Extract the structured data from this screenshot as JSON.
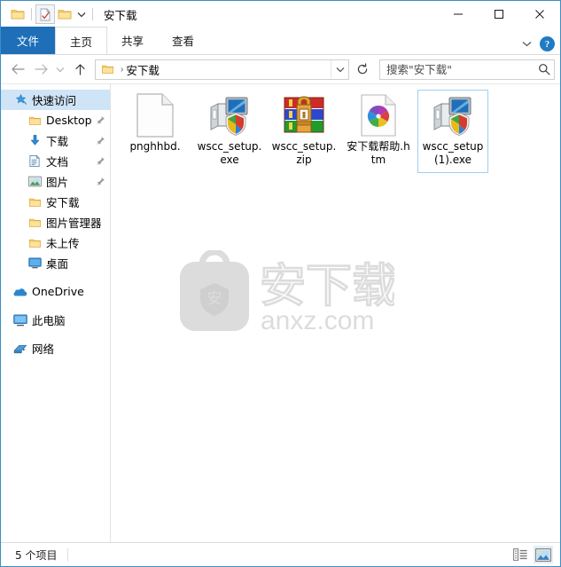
{
  "window": {
    "title": "安下载",
    "quick_access_toolbar": [
      {
        "name": "folder-icon",
        "label": "文件夹"
      },
      {
        "name": "properties-icon",
        "label": "属性"
      },
      {
        "name": "new-folder-icon",
        "label": "新建文件夹"
      },
      {
        "name": "chevron-down-icon",
        "label": "自定义快速访问工具栏"
      }
    ],
    "controls": {
      "minimize": "—",
      "maximize": "▢",
      "close": "✕"
    }
  },
  "ribbon": {
    "tabs": [
      {
        "label": "文件",
        "type": "file"
      },
      {
        "label": "主页",
        "type": "normal"
      },
      {
        "label": "共享",
        "type": "normal"
      },
      {
        "label": "查看",
        "type": "normal"
      }
    ],
    "expand_label": "⌄",
    "help_label": "?"
  },
  "address": {
    "back_label": "←",
    "forward_label": "→",
    "recent_label": "⌄",
    "up_label": "↑",
    "breadcrumb": [
      "安下载"
    ],
    "breadcrumb_separator": "›",
    "dropdown_label": "⌄",
    "refresh_label": "↻"
  },
  "search": {
    "placeholder": "搜索\"安下载\"",
    "value": "",
    "icon": "search-icon"
  },
  "sidebar": {
    "items": [
      {
        "label": "快速访问",
        "icon": "star-pin-icon",
        "level": 0,
        "selected": true,
        "pinned": false
      },
      {
        "label": "Desktop",
        "icon": "folder-icon",
        "level": 1,
        "selected": false,
        "pinned": true
      },
      {
        "label": "下载",
        "icon": "downloads-icon",
        "level": 1,
        "selected": false,
        "pinned": true
      },
      {
        "label": "文档",
        "icon": "documents-icon",
        "level": 1,
        "selected": false,
        "pinned": true
      },
      {
        "label": "图片",
        "icon": "pictures-icon",
        "level": 1,
        "selected": false,
        "pinned": true
      },
      {
        "label": "安下载",
        "icon": "folder-icon",
        "level": 1,
        "selected": false,
        "pinned": false
      },
      {
        "label": "图片管理器",
        "icon": "folder-icon",
        "level": 1,
        "selected": false,
        "pinned": false
      },
      {
        "label": "未上传",
        "icon": "folder-icon",
        "level": 1,
        "selected": false,
        "pinned": false
      },
      {
        "label": "桌面",
        "icon": "desktop-icon",
        "level": 1,
        "selected": false,
        "pinned": false
      },
      {
        "label": "OneDrive",
        "icon": "onedrive-icon",
        "level": 0,
        "selected": false,
        "pinned": false,
        "gap_before": true
      },
      {
        "label": "此电脑",
        "icon": "this-pc-icon",
        "level": 0,
        "selected": false,
        "pinned": false,
        "gap_before": true
      },
      {
        "label": "网络",
        "icon": "network-icon",
        "level": 0,
        "selected": false,
        "pinned": false,
        "gap_before": true
      }
    ]
  },
  "files": [
    {
      "name": "pnghhbd.",
      "icon": "blank-document-icon",
      "selected": false
    },
    {
      "name": "wscc_setup.exe",
      "icon": "installer-exe-icon",
      "selected": false
    },
    {
      "name": "wscc_setup.zip",
      "icon": "winrar-zip-icon",
      "selected": false
    },
    {
      "name": "安下载帮助.htm",
      "icon": "html-document-icon",
      "selected": false
    },
    {
      "name": "wscc_setup (1).exe",
      "icon": "installer-exe-icon",
      "selected": true
    }
  ],
  "watermark": {
    "text": "安",
    "brand": "安下载",
    "domain": "anxz.com"
  },
  "statusbar": {
    "item_count": "5 个项目",
    "views": [
      {
        "name": "details-view-button",
        "label": "详细信息",
        "active": false
      },
      {
        "name": "large-icons-view-button",
        "label": "大图标",
        "active": true
      }
    ]
  },
  "colors": {
    "window_border": "#3c8fc4",
    "file_tab": "#1e6fb8",
    "selection": "#cfe4f7",
    "selected_item_border": "#9fd0f0",
    "watermark": "#e2e2e2"
  }
}
